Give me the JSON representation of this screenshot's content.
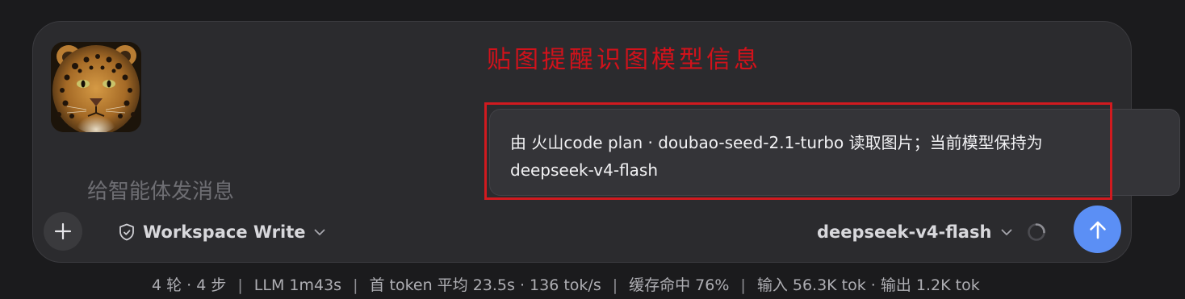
{
  "annotation": {
    "text": "贴图提醒识图模型信息"
  },
  "composer": {
    "placeholder": "给智能体发消息",
    "attachment": {
      "icon": "leopard-image-thumbnail"
    },
    "tooltip": {
      "line1": "由 火山code plan · doubao-seed-2.1-turbo 读取图片；当前模型保持为",
      "line2": "deepseek-v4-flash"
    },
    "toolbar": {
      "add_icon": "plus-icon",
      "permission_icon": "shield-icon",
      "permission_label": "Workspace Write",
      "model_label": "deepseek-v4-flash",
      "send_icon": "arrow-up-icon"
    }
  },
  "status_bar": {
    "items": [
      "4 轮 · 4 步",
      "LLM 1m43s",
      "首 token 平均 23.5s · 136 tok/s",
      "缓存命中 76%",
      "输入 56.3K tok · 输出 1.2K tok"
    ]
  },
  "colors": {
    "background": "#1b1b1d",
    "composer": "#2b2b2e",
    "tooltip": "#343438",
    "annotation": "#d1121b",
    "send_button": "#5b8ff5"
  }
}
